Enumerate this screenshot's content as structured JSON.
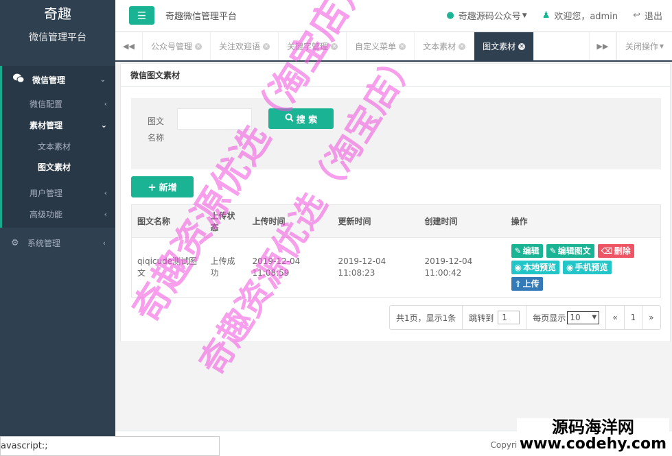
{
  "sidebar": {
    "brand_title": "奇趣",
    "brand_subtitle": "微信管理平台",
    "group_label": "微信管理",
    "items": [
      {
        "label": "微信配置"
      },
      {
        "label": "素材管理"
      },
      {
        "label": "用户管理"
      },
      {
        "label": "高级功能"
      }
    ],
    "sub_items": [
      {
        "label": "文本素材"
      },
      {
        "label": "图文素材"
      }
    ],
    "system_label": "系统管理"
  },
  "header": {
    "title": "奇趣微信管理平台",
    "account_label": "奇趣源码公众号",
    "welcome": "欢迎您，admin",
    "logout": "退出"
  },
  "tabs": [
    {
      "label": "公众号管理"
    },
    {
      "label": "关注欢迎语"
    },
    {
      "label": "关键字管理"
    },
    {
      "label": "自定义菜单"
    },
    {
      "label": "文本素材"
    },
    {
      "label": "图文素材"
    }
  ],
  "tabs_close_label": "关闭操作",
  "panel": {
    "title": "微信图文素材",
    "search_label": "图文名称",
    "search_button": "搜 索",
    "add_button": "新增"
  },
  "table": {
    "headers": [
      "图文名称",
      "上传状态",
      "上传时间",
      "更新时间",
      "创建时间",
      "操作"
    ],
    "rows": [
      {
        "name": "qiqicude测试图文",
        "status": "上传成功",
        "upload_time": "2019-12-04 11:08:59",
        "update_time": "2019-12-04 11:08:23",
        "create_time": "2019-12-04 11:00:42"
      }
    ],
    "actions": {
      "edit": "编辑",
      "edit_content": "编辑图文",
      "delete": "删除",
      "local_preview": "本地预览",
      "mobile_preview": "手机预览",
      "upload": "上传"
    }
  },
  "pager": {
    "summary": "共1页，显示1条",
    "jump_label": "跳转到",
    "jump_value": "1",
    "per_page_label": "每页显示",
    "per_page_value": "10",
    "prev": "«",
    "page": "1",
    "next": "»"
  },
  "footer": {
    "copyright": "Copyright ©"
  },
  "statusbar": {
    "text": "avascript:;"
  },
  "watermarks": {
    "line1": "奇趣资源优选（淘宝店）",
    "line2": "奇趣资源优选（淘宝店）",
    "site_name": "源码海洋网",
    "site_url": "www.codehy.com"
  },
  "colors": {
    "sidebar_bg": "#2f4050",
    "accent": "#1ab394",
    "danger": "#ed5565",
    "info": "#23c6c8",
    "primary": "#337ab7"
  }
}
